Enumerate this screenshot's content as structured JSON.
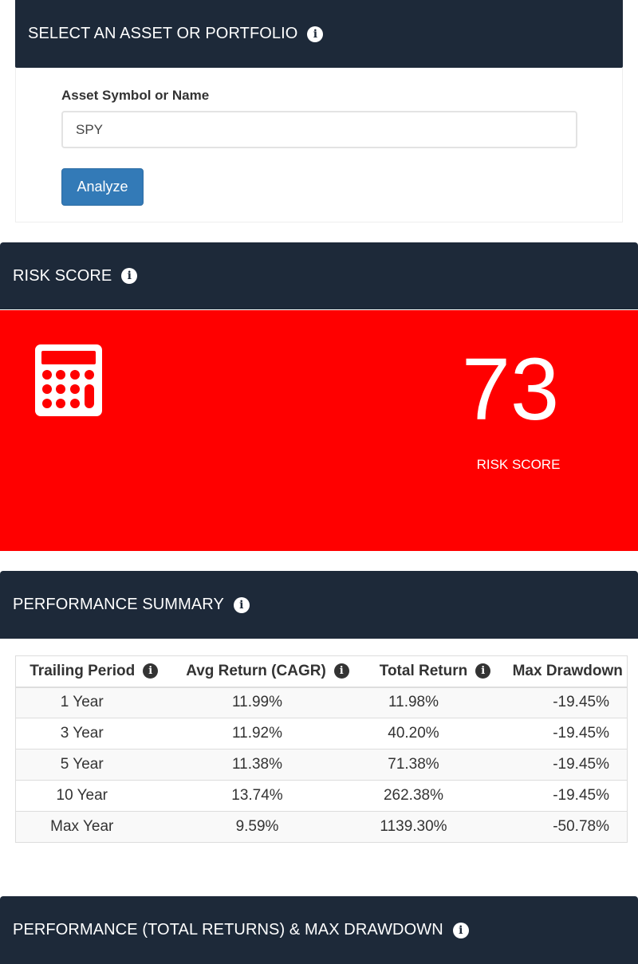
{
  "select_panel": {
    "title": "SELECT AN ASSET OR PORTFOLIO",
    "input_label": "Asset Symbol or Name",
    "input_value": "SPY",
    "analyze_label": "Analyze"
  },
  "risk_panel": {
    "title": "RISK SCORE",
    "score": "73",
    "caption": "RISK SCORE",
    "icon": "calculator-icon",
    "background_color": "#ff0000"
  },
  "performance_summary": {
    "title": "PERFORMANCE SUMMARY",
    "columns": [
      "Trailing Period",
      "Avg Return (CAGR)",
      "Total Return",
      "Max Drawdown"
    ],
    "rows": [
      {
        "period": "1 Year",
        "cagr": "11.99%",
        "total": "11.98%",
        "drawdown": "-19.45%"
      },
      {
        "period": "3 Year",
        "cagr": "11.92%",
        "total": "40.20%",
        "drawdown": "-19.45%"
      },
      {
        "period": "5 Year",
        "cagr": "11.38%",
        "total": "71.38%",
        "drawdown": "-19.45%"
      },
      {
        "period": "10 Year",
        "cagr": "13.74%",
        "total": "262.38%",
        "drawdown": "-19.45%"
      },
      {
        "period": "Max Year",
        "cagr": "9.59%",
        "total": "1139.30%",
        "drawdown": "-50.78%"
      }
    ]
  },
  "chart_panel": {
    "title": "PERFORMANCE (TOTAL RETURNS) & MAX DRAWDOWN"
  },
  "colors": {
    "header_bg": "#1d2939",
    "button_bg": "#337ab7",
    "risk_bg": "#ff0000"
  }
}
